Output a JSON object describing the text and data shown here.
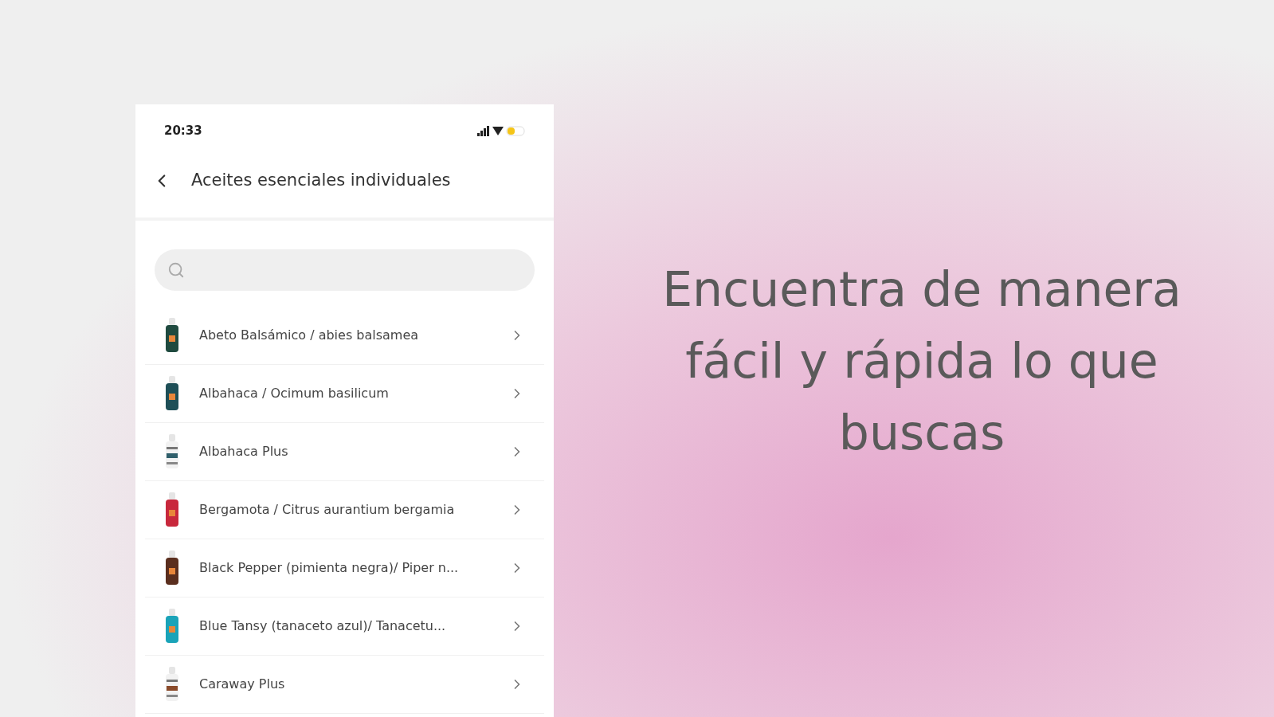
{
  "status_bar": {
    "time": "20:33"
  },
  "header": {
    "title": "Aceites esenciales individuales"
  },
  "items": [
    {
      "name": "Abeto Balsámico / abies balsamea",
      "kind": "solid",
      "color": "#1f4a3f"
    },
    {
      "name": "Albahaca / Ocimum basilicum",
      "kind": "solid",
      "color": "#1e4f57"
    },
    {
      "name": "Albahaca Plus",
      "kind": "striped",
      "color": "#2f5f6b"
    },
    {
      "name": "Bergamota / Citrus aurantium bergamia",
      "kind": "solid",
      "color": "#c8283c"
    },
    {
      "name": "Black Pepper (pimienta negra)/ Piper n...",
      "kind": "solid",
      "color": "#5a2e1e"
    },
    {
      "name": "Blue Tansy (tanaceto azul)/ Tanacetu...",
      "kind": "solid",
      "color": "#1aa3b8"
    },
    {
      "name": "Caraway Plus",
      "kind": "striped",
      "color": "#8a4a2a"
    }
  ],
  "headline": "Encuentra de manera fácil y rápida lo que buscas"
}
